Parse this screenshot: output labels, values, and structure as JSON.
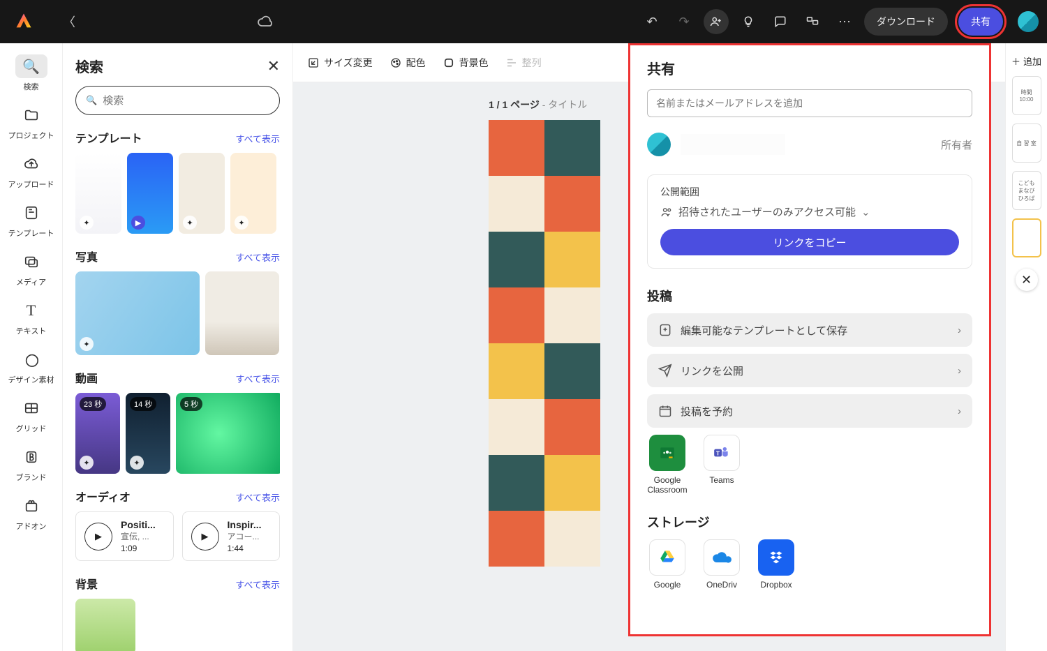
{
  "header": {
    "download_label": "ダウンロード",
    "share_label": "共有"
  },
  "rail": {
    "search": "検索",
    "projects": "プロジェクト",
    "upload": "アップロード",
    "templates": "テンプレート",
    "media": "メディア",
    "text": "テキスト",
    "design_assets": "デザイン素材",
    "grid": "グリッド",
    "brand": "ブランド",
    "addons": "アドオン"
  },
  "panel": {
    "title": "検索",
    "search_placeholder": "検索",
    "show_all": "すべて表示",
    "section_templates": "テンプレート",
    "section_photos": "写真",
    "section_videos": "動画",
    "section_audio": "オーディオ",
    "section_background": "背景",
    "vid1_dur": "23 秒",
    "vid2_dur": "14 秒",
    "vid3_dur": "5 秒",
    "audio1": {
      "title": "Positi...",
      "sub": "宣伝, ...",
      "dur": "1:09"
    },
    "audio2": {
      "title": "Inspir...",
      "sub": "アコー...",
      "dur": "1:44"
    }
  },
  "canvas": {
    "resize": "サイズ変更",
    "color": "配色",
    "bg": "背景色",
    "align": "整列",
    "page_label_a": "1 / 1 ページ",
    "page_label_b": " - タイトル"
  },
  "pages": {
    "add": "追加",
    "p1": "時間\n10:00",
    "p2": "自 習 室",
    "p3": "こども\nまなび\nひろば"
  },
  "share": {
    "title": "共有",
    "invite_placeholder": "名前またはメールアドレスを追加",
    "role_owner": "所有者",
    "visibility_label": "公開範囲",
    "visibility_value": "招待されたユーザーのみアクセス可能",
    "copy_link": "リンクをコピー",
    "post_title": "投稿",
    "save_template": "編集可能なテンプレートとして保存",
    "publish_link": "リンクを公開",
    "schedule_post": "投稿を予約",
    "gc": "Google Classroom",
    "teams": "Teams",
    "storage_title": "ストレージ",
    "gdrive": "Google",
    "onedrive": "OneDriv",
    "dropbox": "Dropbox"
  }
}
